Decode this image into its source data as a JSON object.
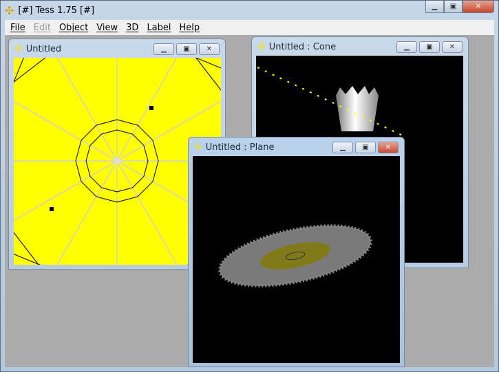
{
  "app": {
    "title": "[#] Tess 1.75 [#]",
    "icon": "tess-logo-icon"
  },
  "menu": [
    {
      "label": "File",
      "enabled": true
    },
    {
      "label": "Edit",
      "enabled": false
    },
    {
      "label": "Object",
      "enabled": true
    },
    {
      "label": "View",
      "enabled": true
    },
    {
      "label": "3D",
      "enabled": true
    },
    {
      "label": "Label",
      "enabled": true
    },
    {
      "label": "Help",
      "enabled": true
    }
  ],
  "windows": {
    "untitled": {
      "title": "Untitled",
      "bg": "#ffff00"
    },
    "cone": {
      "title": "Untitled : Cone",
      "bg": "#000000"
    },
    "plane": {
      "title": "Untitled : Plane",
      "bg": "#000000"
    }
  },
  "controls": {
    "minimize": "▁",
    "maximize": "▣",
    "close": "✕"
  }
}
